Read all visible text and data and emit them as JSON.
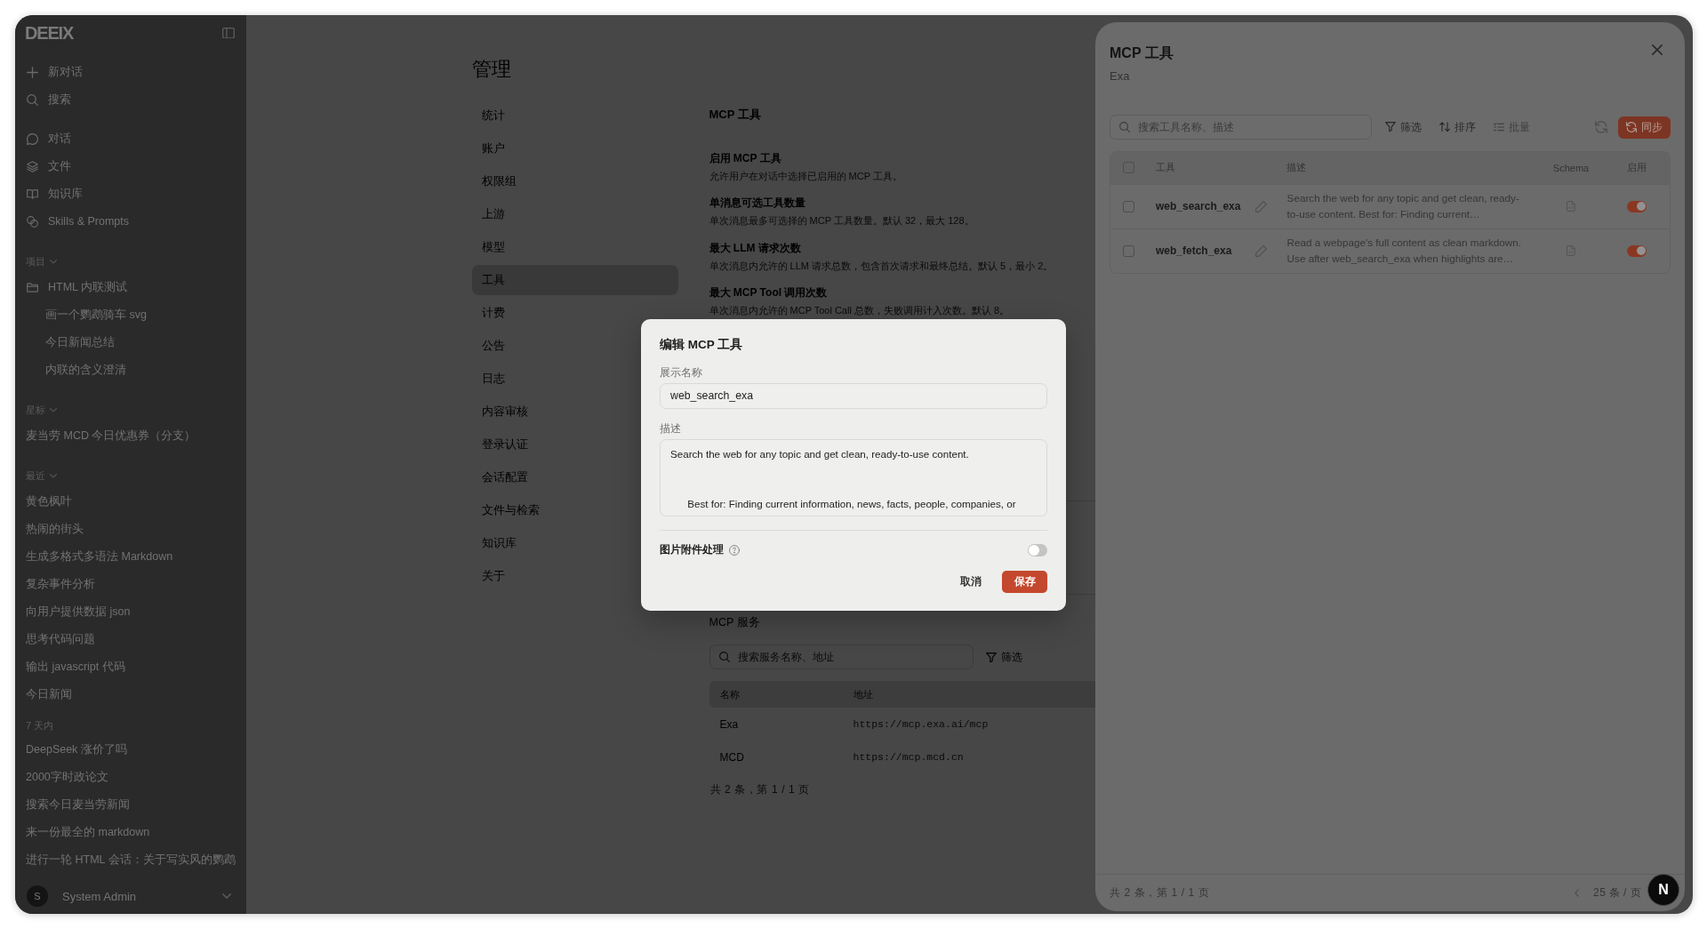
{
  "sidebar": {
    "logo": "DEEIX",
    "actions": [
      {
        "label": "新对话"
      },
      {
        "label": "搜索"
      }
    ],
    "nav": [
      {
        "label": "对话"
      },
      {
        "label": "文件"
      },
      {
        "label": "知识库"
      },
      {
        "label": "Skills & Prompts"
      }
    ],
    "sections": [
      {
        "title": "项目",
        "expanded": true,
        "items": [
          {
            "label": "HTML 内联测试",
            "children": [
              {
                "label": "画一个鹦鹉骑车 svg"
              },
              {
                "label": "今日新闻总结"
              },
              {
                "label": "内联的含义澄清"
              }
            ]
          }
        ]
      },
      {
        "title": "星标",
        "expanded": true,
        "items": [
          {
            "label": "麦当劳 MCD 今日优惠券（分支）"
          }
        ]
      },
      {
        "title": "最近",
        "expanded": true,
        "items": [
          {
            "label": "黄色枫叶"
          },
          {
            "label": "热闹的街头"
          },
          {
            "label": "生成多格式多语法 Markdown"
          },
          {
            "label": "复杂事件分析"
          },
          {
            "label": "向用户提供数据 json"
          },
          {
            "label": "思考代码问题"
          },
          {
            "label": "输出 javascript 代码"
          },
          {
            "label": "今日新闻"
          }
        ]
      },
      {
        "title": "7 天内",
        "items": [
          {
            "label": "DeepSeek 涨价了吗"
          },
          {
            "label": "2000字时政论文"
          },
          {
            "label": "搜索今日麦当劳新闻"
          },
          {
            "label": "来一份最全的 markdown"
          },
          {
            "label": "进行一轮 HTML 会话：关于写实风的鹦鹉"
          }
        ]
      }
    ],
    "user": {
      "avatar": "S",
      "name": "System Admin"
    }
  },
  "admin": {
    "title": "管理",
    "nav": [
      {
        "label": "统计",
        "selected": false
      },
      {
        "label": "账户",
        "selected": false
      },
      {
        "label": "权限组",
        "selected": false
      },
      {
        "label": "上游",
        "selected": false
      },
      {
        "label": "模型",
        "selected": false
      },
      {
        "label": "工具",
        "selected": true
      },
      {
        "label": "计费",
        "selected": false
      },
      {
        "label": "公告",
        "selected": false
      },
      {
        "label": "日志",
        "selected": false
      },
      {
        "label": "内容审核",
        "selected": false
      },
      {
        "label": "登录认证",
        "selected": false
      },
      {
        "label": "会话配置",
        "selected": false
      },
      {
        "label": "文件与检索",
        "selected": false
      },
      {
        "label": "知识库",
        "selected": false
      },
      {
        "label": "关于",
        "selected": false
      }
    ],
    "section_title": "MCP 工具",
    "settings": [
      {
        "label": "启用 MCP 工具",
        "description": "允许用户在对话中选择已启用的 MCP 工具。"
      },
      {
        "label": "单消息可选工具数量",
        "description": "单次消息最多可选择的 MCP 工具数量。默认 32，最大 128。"
      },
      {
        "label": "最大 LLM 请求次数",
        "description": "单次消息内允许的 LLM 请求总数，包含首次请求和最终总结。默认 5，最小 2。"
      },
      {
        "label": "最大 MCP Tool 调用次数",
        "description": "单次消息内允许的 MCP Tool Call 总数，失败调用计入次数。默认 8。"
      }
    ],
    "services": {
      "title": "MCP 服务",
      "search": {
        "placeholder": "搜索服务名称、地址"
      },
      "filter": "筛选",
      "columns": [
        "名称",
        "地址"
      ],
      "rows": [
        [
          "Exa",
          "https://mcp.exa.ai/mcp"
        ],
        [
          "MCD",
          "https://mcp.mcd.cn"
        ]
      ],
      "pagination": "共 2 条，第 1 / 1 页"
    }
  },
  "drawer": {
    "title": "MCP 工具",
    "subtitle": "Exa",
    "search": {
      "placeholder": "搜索工具名称、描述"
    },
    "toolbar": [
      {
        "label": "筛选",
        "disabled": false
      },
      {
        "label": "排序",
        "disabled": false
      },
      {
        "label": "批量",
        "disabled": true
      }
    ],
    "sync_button": "同步",
    "table": {
      "all_checked": false,
      "columns": [
        "工具",
        "描述",
        "Schema",
        "启用"
      ],
      "rows": [
        {
          "checked": false,
          "name": "web_search_exa",
          "description": "Search the web for any topic and get clean, ready-to-use content. Best for: Finding current…",
          "enabled": true
        },
        {
          "checked": false,
          "name": "web_fetch_exa",
          "description": "Read a webpage's full content as clean markdown. Use after web_search_exa when highlights are…",
          "enabled": true
        }
      ]
    },
    "pagination": "共 2 条，第 1 / 1 页",
    "page_size": "25 条 / 页"
  },
  "dialog": {
    "title": "编辑 MCP 工具",
    "fields": [
      {
        "kind": "input",
        "label": "展示名称",
        "value": "web_search_exa"
      },
      {
        "kind": "textarea",
        "label": "描述",
        "value": "Search the web for any topic and get clean, ready-to-use content.\n\n\n      Best for: Finding current information, news, facts, people, companies, or"
      }
    ],
    "toggle": {
      "label": "图片附件处理",
      "on": false
    },
    "buttons": [
      {
        "kind": "text",
        "label": "取消"
      },
      {
        "kind": "primary",
        "label": "保存"
      }
    ]
  },
  "dev_badge": {
    "label": "N"
  }
}
